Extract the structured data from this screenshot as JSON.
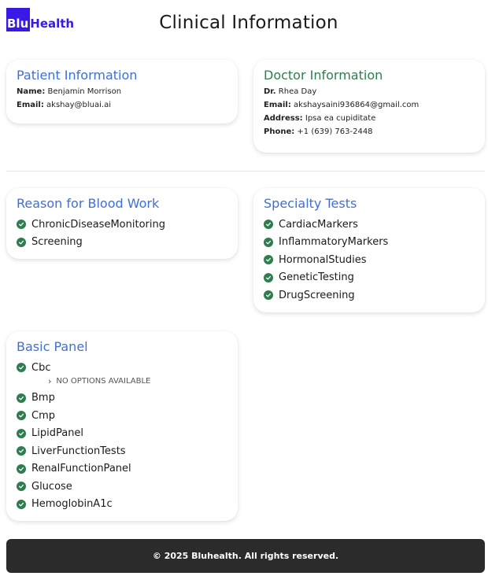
{
  "brand": {
    "logo_part1": "Blu",
    "logo_part2": "Health"
  },
  "page": {
    "title": "Clinical Information"
  },
  "patient": {
    "title": "Patient Information",
    "name_label": "Name:",
    "name": "Benjamin Morrison",
    "email_label": "Email:",
    "email": "akshay@bluai.ai"
  },
  "doctor": {
    "title": "Doctor Information",
    "name_label": "Dr.",
    "name": "Rhea Day",
    "email_label": "Email:",
    "email": "akshaysaini936864@gmail.com",
    "address_label": "Address:",
    "address": "Ipsa ea cupiditate",
    "phone_label": "Phone:",
    "phone": "+1 (639) 763-2448"
  },
  "reason": {
    "title": "Reason for Blood Work",
    "items": [
      "ChronicDiseaseMonitoring",
      "Screening"
    ]
  },
  "specialty": {
    "title": "Specialty Tests",
    "items": [
      "CardiacMarkers",
      "InflammatoryMarkers",
      "HormonalStudies",
      "GeneticTesting",
      "DrugScreening"
    ]
  },
  "basic": {
    "title": "Basic Panel",
    "items": [
      "Cbc",
      "Bmp",
      "Cmp",
      "LipidPanel",
      "LiverFunctionTests",
      "RenalFunctionPanel",
      "Glucose",
      "HemoglobinA1c"
    ],
    "cbc_note": "NO OPTIONS AVAILABLE"
  },
  "footer": {
    "text": "© 2025 Bluhealth. All rights reserved."
  },
  "colors": {
    "brand": "#3a18e6",
    "title_blue": "#3f6fd8",
    "title_green": "#2f7d4f",
    "check_green": "#2f7d4f",
    "footer_bg": "#2b2b2b"
  }
}
